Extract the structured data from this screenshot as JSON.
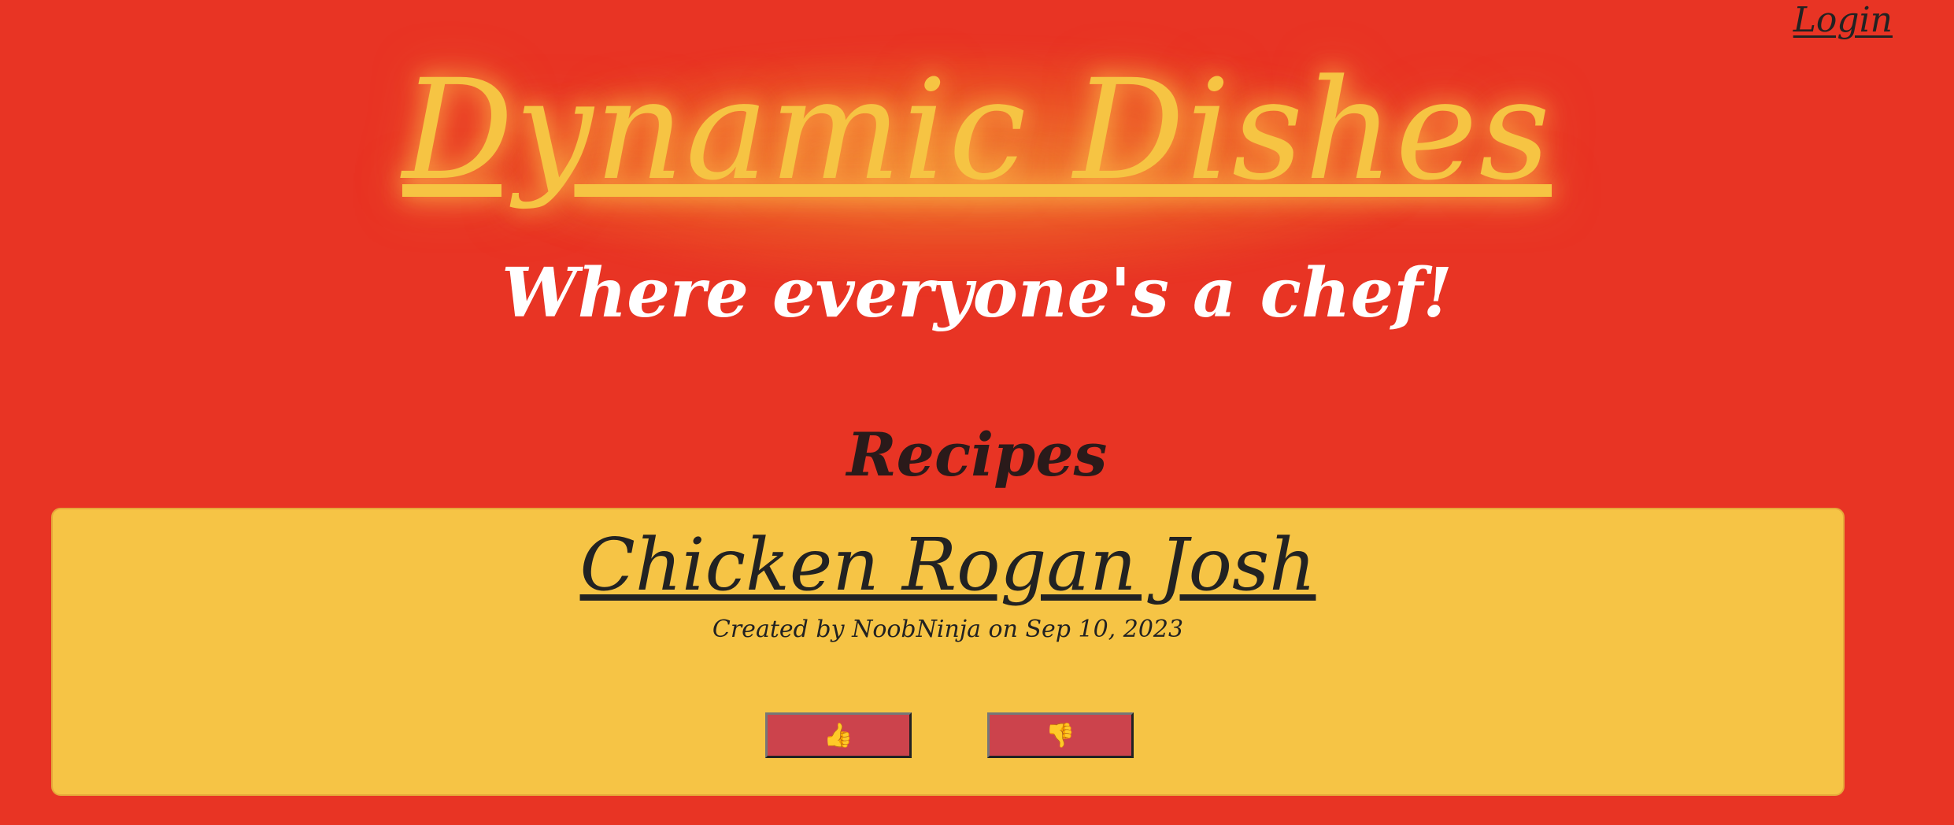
{
  "header": {
    "login_label": "Login",
    "site_title": "Dynamic Dishes",
    "tagline": "Where everyone's a chef!"
  },
  "main": {
    "section_title": "Recipes",
    "recipes": [
      {
        "title": "Chicken Rogan Josh",
        "meta": "Created by NoobNinja on Sep 10, 2023",
        "upvote_icon": "👍",
        "downvote_icon": "👎"
      }
    ]
  },
  "colors": {
    "background": "#e83424",
    "title_gold": "#f6c443",
    "card_bg": "#f6c445",
    "vote_button": "#cc434c"
  }
}
